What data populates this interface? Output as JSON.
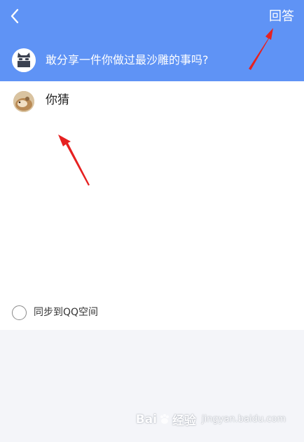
{
  "header": {
    "answer_label": "回答",
    "question_text": "敢分享一件你做过最沙雕的事吗?"
  },
  "answer": {
    "text": "你猜"
  },
  "sync": {
    "label": "同步到QQ空间",
    "checked": false
  },
  "watermark": {
    "brand_left": "Bai",
    "brand_right": "经验",
    "sub_text": "jingyan.baidu.com"
  },
  "colors": {
    "header_bg": "#5f93f5",
    "annotation_arrow": "#e62121"
  }
}
